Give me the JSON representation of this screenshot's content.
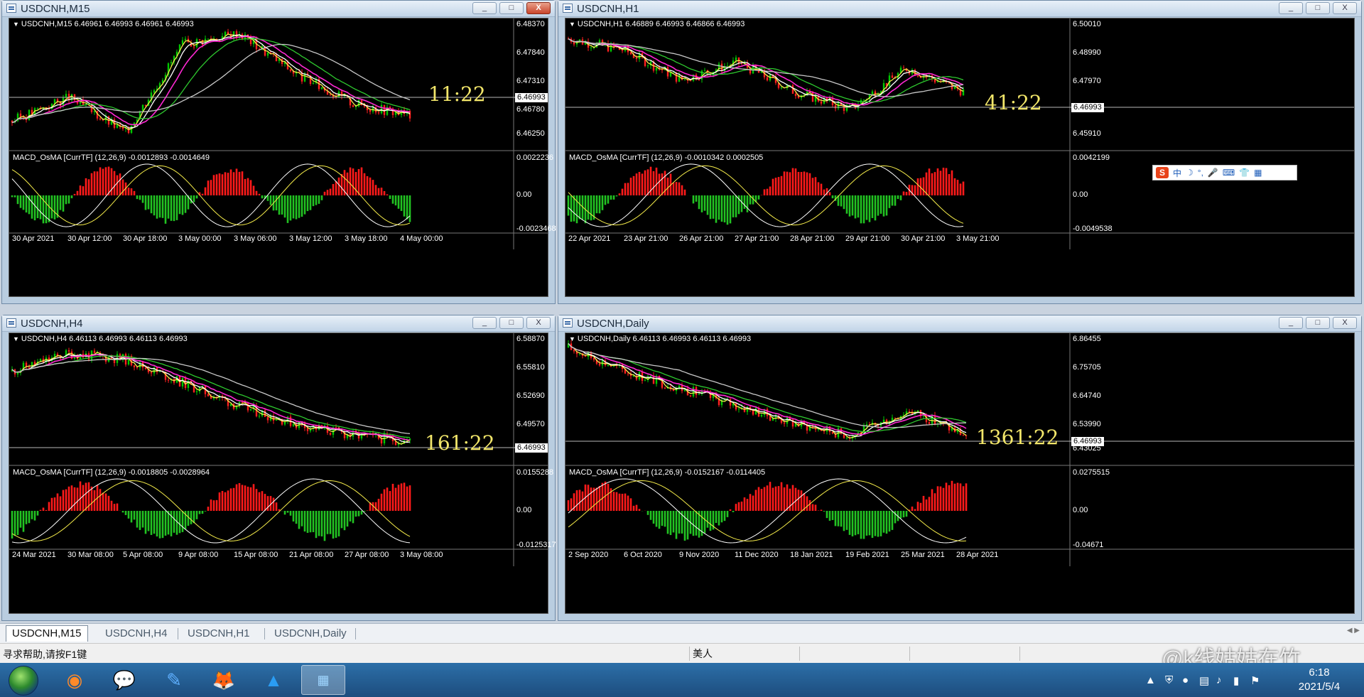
{
  "colors": {
    "bull": "#00c800",
    "bear": "#ff2020",
    "macd_up": "#ff1a1a",
    "macd_down": "#22c322",
    "ma_yellow": "#f5ec4a",
    "ma_magenta": "#ff28d4",
    "ma_green": "#2ec82e",
    "ma_gray": "#c8c8c8",
    "current_line": "#b8b8b8",
    "timer": "#f2e66a",
    "grid": "#000000"
  },
  "windows": [
    {
      "title": "USDCNH,M15",
      "price_header": "USDCNH,M15  6.46961 6.46993 6.46961 6.46993",
      "price_labels": [
        "6.48370",
        "6.47840",
        "6.47310",
        "6.46780",
        "6.46250"
      ],
      "current_price": "6.46993",
      "timer": "11:22",
      "macd_header": "MACD_OsMA [CurrTF] (12,26,9) -0.0012893 -0.0014649",
      "macd_labels": [
        "0.0022236",
        "0.00",
        "-0.0023468"
      ],
      "time_labels": [
        "30 Apr 2021",
        "30 Apr 12:00",
        "30 Apr 18:00",
        "3 May 00:00",
        "3 May 06:00",
        "3 May 12:00",
        "3 May 18:00",
        "4 May 00:00"
      ],
      "controls": {
        "minimize": "_",
        "restore": "□",
        "close": "X"
      }
    },
    {
      "title": "USDCNH,H1",
      "price_header": "USDCNH,H1  6.46889 6.46993 6.46866 6.46993",
      "price_labels": [
        "6.50010",
        "6.48990",
        "6.47970",
        "6.46993",
        "6.45910"
      ],
      "current_price": "6.46993",
      "timer": "41:22",
      "macd_header": "MACD_OsMA [CurrTF] (12,26,9) -0.0010342 0.0002505",
      "macd_labels": [
        "0.0042199",
        "0.00",
        "-0.0049538"
      ],
      "time_labels": [
        "22 Apr 2021",
        "23 Apr 21:00",
        "26 Apr 21:00",
        "27 Apr 21:00",
        "28 Apr 21:00",
        "29 Apr 21:00",
        "30 Apr 21:00",
        "3 May 21:00"
      ],
      "controls": {
        "minimize": "_",
        "restore": "□",
        "close": "X"
      }
    },
    {
      "title": "USDCNH,H4",
      "price_header": "USDCNH,H4  6.46113 6.46993 6.46113 6.46993",
      "price_labels": [
        "6.58870",
        "6.55810",
        "6.52690",
        "6.49570",
        "6.46993"
      ],
      "current_price": "6.46993",
      "timer": "161:22",
      "macd_header": "MACD_OsMA [CurrTF] (12,26,9) -0.0018805 -0.0028964",
      "macd_labels": [
        "0.0155288",
        "0.00",
        "-0.0125317"
      ],
      "time_labels": [
        "24 Mar 2021",
        "30 Mar 08:00",
        "5 Apr 08:00",
        "9 Apr 08:00",
        "15 Apr 08:00",
        "21 Apr 08:00",
        "27 Apr 08:00",
        "3 May 08:00"
      ],
      "controls": {
        "minimize": "_",
        "restore": "□",
        "close": "X"
      }
    },
    {
      "title": "USDCNH,Daily",
      "price_header": "USDCNH,Daily  6.46113 6.46993 6.46113 6.46993",
      "price_labels": [
        "6.86455",
        "6.75705",
        "6.64740",
        "6.53990",
        "6.43025"
      ],
      "current_price": "6.46993",
      "timer": "1361:22",
      "macd_header": "MACD_OsMA [CurrTF] (12,26,9) -0.0152167 -0.0114405",
      "macd_labels": [
        "0.0275515",
        "0.00",
        "-0.04671"
      ],
      "time_labels": [
        "2 Sep 2020",
        "6 Oct 2020",
        "9 Nov 2020",
        "11 Dec 2020",
        "18 Jan 2021",
        "19 Feb 2021",
        "25 Mar 2021",
        "28 Apr 2021"
      ],
      "controls": {
        "minimize": "_",
        "restore": "□",
        "close": "X"
      }
    }
  ],
  "ime_toolbar": {
    "logo": "S",
    "items": [
      "中",
      "☽",
      "°,",
      "🎤",
      "⌨",
      "👕",
      "▦"
    ]
  },
  "tabs": [
    "USDCNH,M15",
    "USDCNH,H4",
    "USDCNH,H1",
    "USDCNH,Daily"
  ],
  "tab_nav": "◀ ▶",
  "status": {
    "help": "寻求帮助,请按F1键",
    "profile": "美人"
  },
  "taskbar": {
    "apps": [
      "start-orb-icon",
      "sogou-icon",
      "wechat-icon",
      "feishu-icon",
      "firefox-icon",
      "tencent-meeting-icon",
      "trading-app-icon"
    ],
    "time": "6:18",
    "date": "2021/5/4"
  },
  "watermark": "@k线姑姑在竹"
}
